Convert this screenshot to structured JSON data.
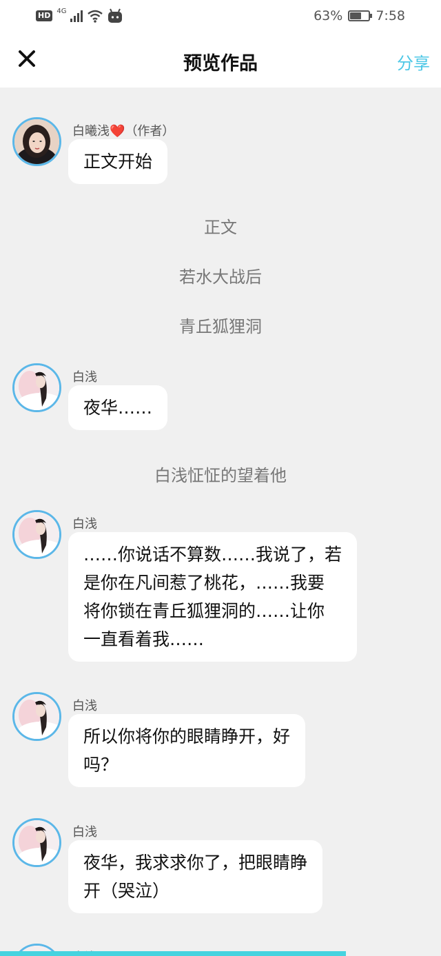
{
  "status_bar": {
    "hd_label": "HD",
    "network_label": "4G",
    "battery_percent": "63%",
    "battery_level": 0.63,
    "time": "7:58",
    "icons": [
      "hd-icon",
      "signal-icon",
      "wifi-icon",
      "notification-icon",
      "battery-icon"
    ]
  },
  "nav": {
    "title": "预览作品",
    "share_label": "分享",
    "close_icon": "close-icon",
    "accent_color": "#4cc7e6"
  },
  "messages": [
    {
      "type": "message",
      "sender": "白曦浅",
      "heart": "❤️",
      "role_tag": "（作者）",
      "lines": [
        "正文开始"
      ]
    },
    {
      "type": "narration",
      "text": "正文"
    },
    {
      "type": "narration",
      "text": "若水大战后"
    },
    {
      "type": "narration",
      "text": "青丘狐狸洞"
    },
    {
      "type": "message",
      "sender": "白浅",
      "lines": [
        "夜华……"
      ]
    },
    {
      "type": "narration",
      "text": "白浅怔怔的望着他"
    },
    {
      "type": "message",
      "sender": "白浅",
      "lines": [
        "……你说话不算数……我说了，若",
        "是你在凡间惹了桃花，……我要",
        "将你锁在青丘狐狸洞的……让你",
        "一直看着我……"
      ]
    },
    {
      "type": "message",
      "sender": "白浅",
      "lines": [
        "所以你将你的眼睛睁开，好",
        "吗？"
      ]
    },
    {
      "type": "message",
      "sender": "白浅",
      "lines": [
        "夜华，我求求你了，把眼睛睁",
        "开（哭泣）"
      ]
    },
    {
      "type": "message",
      "sender": "白浅",
      "lines": []
    }
  ]
}
